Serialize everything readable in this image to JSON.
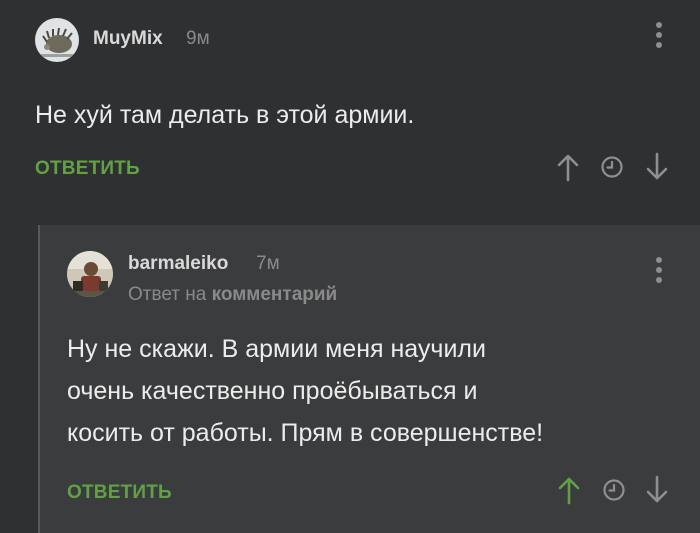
{
  "comments": [
    {
      "author": "MuyMix",
      "time": "9м",
      "text": "Не хуй там делать в этой армии.",
      "reply_label": "ОТВЕТИТЬ",
      "icons": [
        "more-vertical-icon",
        "arrow-up-icon",
        "clock-icon",
        "arrow-down-icon"
      ]
    },
    {
      "author": "barmaleiko",
      "time": "7м",
      "reply_to_prefix": "Ответ на",
      "reply_to_target": "комментарий",
      "text_lines": [
        "Ну не скажи. В армии меня научили",
        "очень качественно проёбываться и",
        "косить от работы. Прям в совершенстве!"
      ],
      "reply_label": "ОТВЕТИТЬ",
      "upvoted": true,
      "icons": [
        "more-vertical-icon",
        "arrow-up-icon",
        "clock-icon",
        "arrow-down-icon"
      ]
    }
  ],
  "colors": {
    "background": "#2f3032",
    "nested_background": "#3b3c3e",
    "accent_green": "#62a046",
    "muted": "#8a8a8a"
  }
}
